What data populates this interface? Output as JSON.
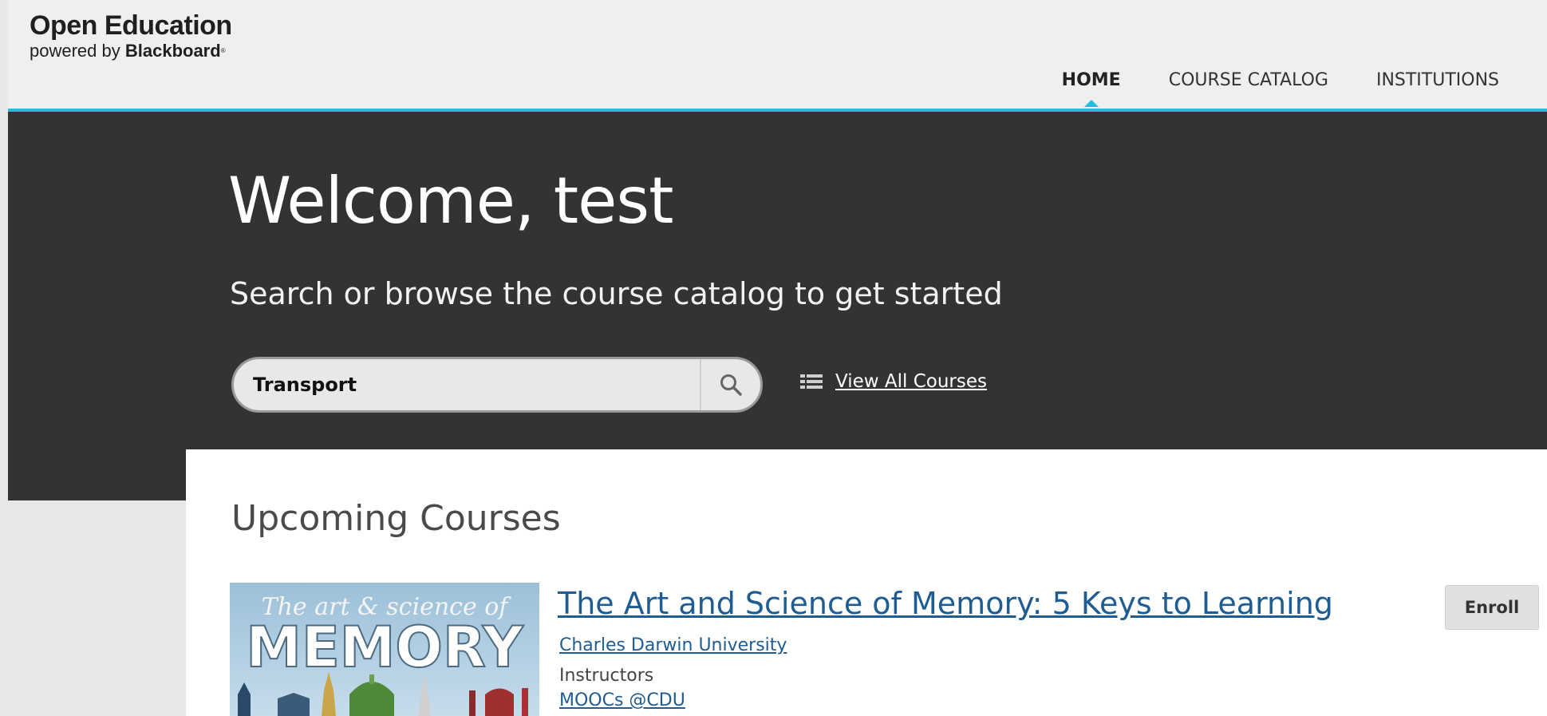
{
  "header": {
    "logo_main": "Open Education",
    "logo_sub_prefix": "powered by ",
    "logo_sub_brand": "Blackboard",
    "logo_tm": "®",
    "accent_color": "#2fb8de",
    "nav": [
      {
        "label": "HOME",
        "active": true
      },
      {
        "label": "COURSE CATALOG",
        "active": false
      },
      {
        "label": "INSTITUTIONS",
        "active": false
      }
    ]
  },
  "hero": {
    "title": "Welcome, test",
    "subtitle": "Search or browse the course catalog to get started",
    "search": {
      "value": "Transport",
      "placeholder": "",
      "button_icon": "search-icon"
    },
    "view_all": {
      "label": "View All Courses",
      "icon": "list-icon"
    }
  },
  "upcoming": {
    "heading": "Upcoming Courses",
    "courses": [
      {
        "thumbnail": {
          "line1": "The art & science of",
          "line2": "MEMORY"
        },
        "title": "The Art and Science of Memory: 5 Keys to Learning",
        "institution": "Charles Darwin University",
        "instructors_label": "Instructors",
        "instructor": "MOOCs @CDU",
        "enroll_label": "Enroll"
      }
    ]
  }
}
